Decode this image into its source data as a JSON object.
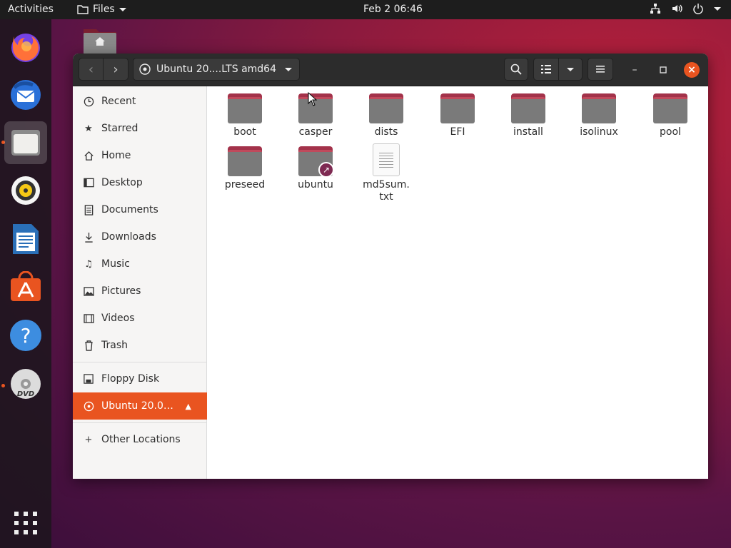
{
  "topbar": {
    "activities": "Activities",
    "app_menu": "Files",
    "clock": "Feb 2  06:46"
  },
  "dock": {
    "apps": [
      "firefox-icon",
      "thunderbird-icon",
      "files-icon",
      "rhythmbox-icon",
      "libreoffice-writer-icon",
      "ubuntu-software-icon",
      "help-icon",
      "dvd-icon",
      "show-apps-icon"
    ]
  },
  "window": {
    "path_label": "Ubuntu 20....LTS amd64"
  },
  "sidebar": {
    "items": [
      {
        "label": "Recent",
        "icon": "clock-icon"
      },
      {
        "label": "Starred",
        "icon": "star-icon"
      },
      {
        "label": "Home",
        "icon": "home-icon"
      },
      {
        "label": "Desktop",
        "icon": "desktop-icon"
      },
      {
        "label": "Documents",
        "icon": "documents-icon"
      },
      {
        "label": "Downloads",
        "icon": "download-icon"
      },
      {
        "label": "Music",
        "icon": "music-icon"
      },
      {
        "label": "Pictures",
        "icon": "pictures-icon"
      },
      {
        "label": "Videos",
        "icon": "videos-icon"
      },
      {
        "label": "Trash",
        "icon": "trash-icon"
      }
    ],
    "devices": [
      {
        "label": "Floppy Disk",
        "icon": "floppy-icon"
      },
      {
        "label": "Ubuntu 20.0…",
        "icon": "disc-icon",
        "selected": true
      }
    ],
    "other": "Other Locations"
  },
  "files": [
    {
      "name": "boot",
      "type": "folder"
    },
    {
      "name": "casper",
      "type": "folder"
    },
    {
      "name": "dists",
      "type": "folder"
    },
    {
      "name": "EFI",
      "type": "folder"
    },
    {
      "name": "install",
      "type": "folder"
    },
    {
      "name": "isolinux",
      "type": "folder"
    },
    {
      "name": "pool",
      "type": "folder"
    },
    {
      "name": "preseed",
      "type": "folder"
    },
    {
      "name": "ubuntu",
      "type": "folder-link"
    },
    {
      "name": "md5sum.\ntxt",
      "type": "text"
    }
  ],
  "colors": {
    "accent": "#e95420",
    "headerbar": "#2c2c2c",
    "topbar": "#1d1d1d"
  }
}
